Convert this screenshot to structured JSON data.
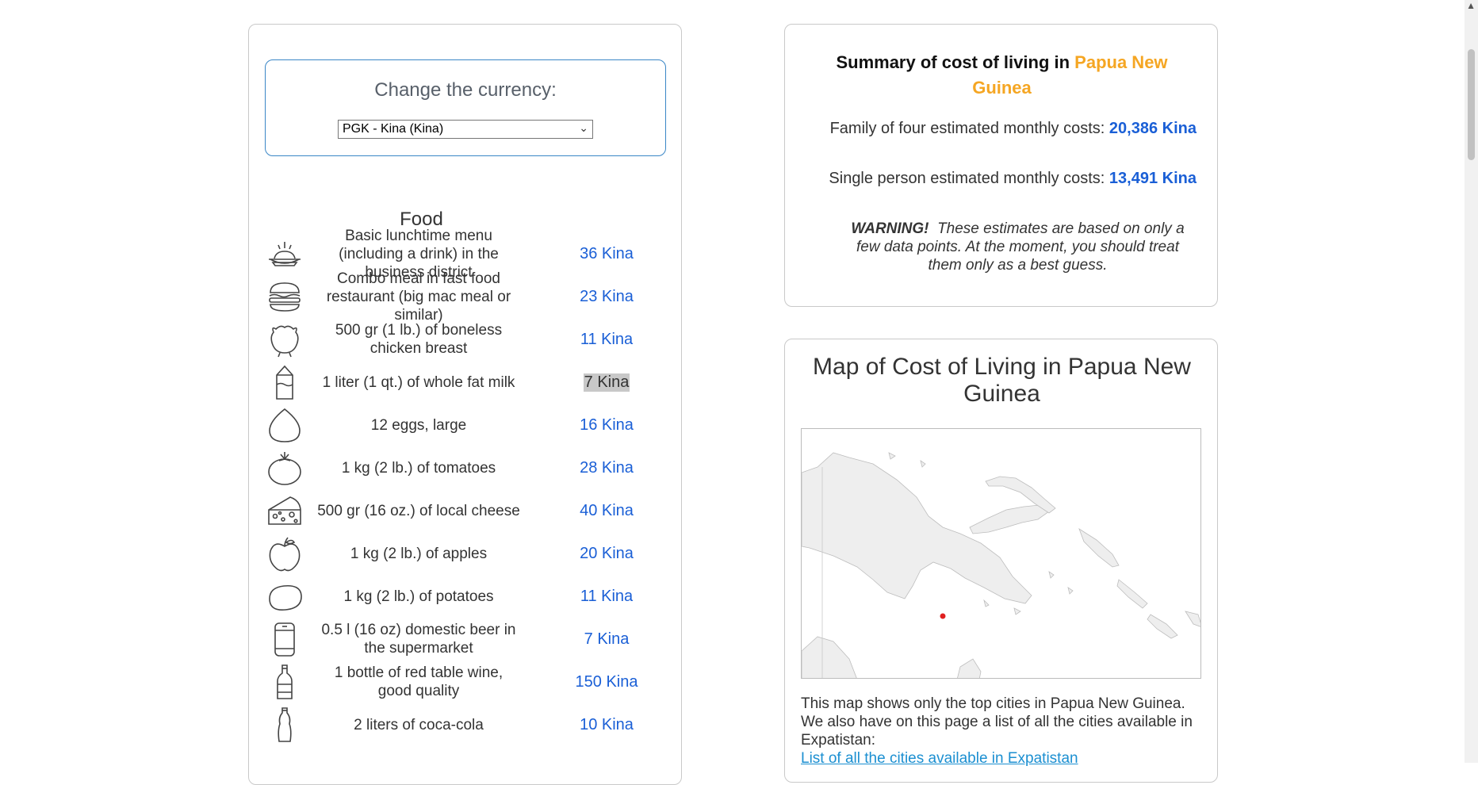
{
  "currency": {
    "title": "Change the currency:",
    "selected": "PGK - Kina (Kina)"
  },
  "food": {
    "heading": "Food",
    "items": [
      {
        "label": "Basic lunchtime menu (including a drink) in the business district",
        "price": "36 Kina",
        "icon": "lunch-plate-icon"
      },
      {
        "label": "Combo meal in fast food restaurant (big mac meal or similar)",
        "price": "23 Kina",
        "icon": "burger-icon"
      },
      {
        "label": "500 gr (1 lb.) of boneless chicken breast",
        "price": "11 Kina",
        "icon": "chicken-icon"
      },
      {
        "label": "1 liter (1 qt.) of whole fat milk",
        "price": "7 Kina",
        "icon": "milk-carton-icon",
        "highlighted": true
      },
      {
        "label": "12 eggs, large",
        "price": "16 Kina",
        "icon": "egg-icon"
      },
      {
        "label": "1 kg (2 lb.) of tomatoes",
        "price": "28 Kina",
        "icon": "tomato-icon"
      },
      {
        "label": "500 gr (16 oz.) of local cheese",
        "price": "40 Kina",
        "icon": "cheese-icon"
      },
      {
        "label": "1 kg (2 lb.) of apples",
        "price": "20 Kina",
        "icon": "apple-icon"
      },
      {
        "label": "1 kg (2 lb.) of potatoes",
        "price": "11 Kina",
        "icon": "potato-icon"
      },
      {
        "label": "0.5 l (16 oz) domestic beer in the supermarket",
        "price": "7 Kina",
        "icon": "beer-can-icon"
      },
      {
        "label": "1 bottle of red table wine, good quality",
        "price": "150 Kina",
        "icon": "wine-bottle-icon"
      },
      {
        "label": "2 liters of coca-cola",
        "price": "10 Kina",
        "icon": "cola-bottle-icon"
      }
    ]
  },
  "summary": {
    "title_prefix": "Summary of cost of living in",
    "country": "Papua New Guinea",
    "family_label": "Family of four estimated monthly costs:",
    "family_amount": "20,386 Kina",
    "single_label": "Single person estimated monthly costs:",
    "single_amount": "13,491 Kina",
    "warning_label": "WARNING!",
    "warning_text": "These estimates are based on only a few data points. At the moment, you should treat them only as a best guess."
  },
  "map": {
    "title": "Map of Cost of Living in Papua New Guinea",
    "description": "This map shows only the top cities in Papua New Guinea. We also have on this page a list of all the cities available in Expatistan:",
    "link": "List of all the cities available in Expatistan",
    "marker_color": "#e02020"
  },
  "colors": {
    "accent_blue": "#1a5fd6",
    "country_orange": "#f5a623",
    "currency_border": "#3a86c6"
  }
}
